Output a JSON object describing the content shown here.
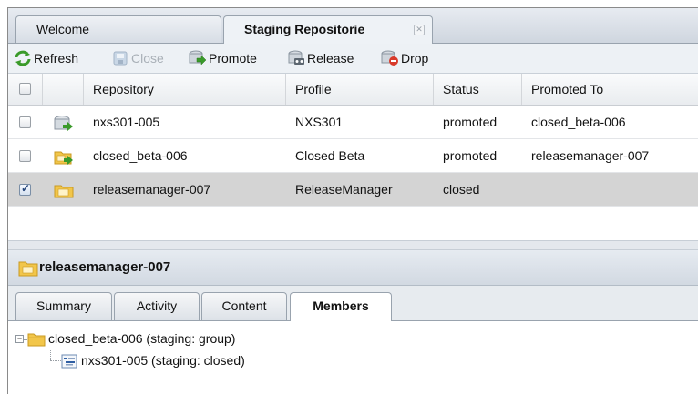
{
  "tabs": [
    {
      "label": "Welcome",
      "active": false
    },
    {
      "label": "Staging Repositorie",
      "active": true,
      "closable": true
    }
  ],
  "toolbar": {
    "refresh": {
      "label": "Refresh",
      "icon": "refresh-icon",
      "enabled": true
    },
    "close": {
      "label": "Close",
      "icon": "close-repo-icon",
      "enabled": false
    },
    "promote": {
      "label": "Promote",
      "icon": "promote-icon",
      "enabled": true
    },
    "release": {
      "label": "Release",
      "icon": "release-icon",
      "enabled": true
    },
    "drop": {
      "label": "Drop",
      "icon": "drop-icon",
      "enabled": true
    }
  },
  "grid": {
    "columns": [
      "Repository",
      "Profile",
      "Status",
      "Promoted To"
    ],
    "rows": [
      {
        "repository": "nxs301-005",
        "profile": "NXS301",
        "status": "promoted",
        "promoted_to": "closed_beta-006",
        "checked": false,
        "icon": "repository-icon"
      },
      {
        "repository": "closed_beta-006",
        "profile": "Closed Beta",
        "status": "promoted",
        "promoted_to": "releasemanager-007",
        "checked": false,
        "icon": "group-folder-icon"
      },
      {
        "repository": "releasemanager-007",
        "profile": "ReleaseManager",
        "status": "closed",
        "promoted_to": "",
        "checked": true,
        "icon": "group-folder-icon",
        "selected": true
      }
    ]
  },
  "detail": {
    "title": "releasemanager-007",
    "tabs": [
      {
        "label": "Summary",
        "active": false
      },
      {
        "label": "Activity",
        "active": false
      },
      {
        "label": "Content",
        "active": false
      },
      {
        "label": "Members",
        "active": true
      }
    ],
    "tree": [
      {
        "label": "closed_beta-006 (staging: group)",
        "expanded": true,
        "icon": "folder-icon"
      },
      {
        "label": "nxs301-005 (staging: closed)",
        "icon": "repository-leaf-icon"
      }
    ]
  },
  "colors": {
    "accent_green": "#3a9a2a",
    "folder": "#f2c64a",
    "drop_red": "#d83a2a",
    "selected_row": "#d4d4d4"
  }
}
